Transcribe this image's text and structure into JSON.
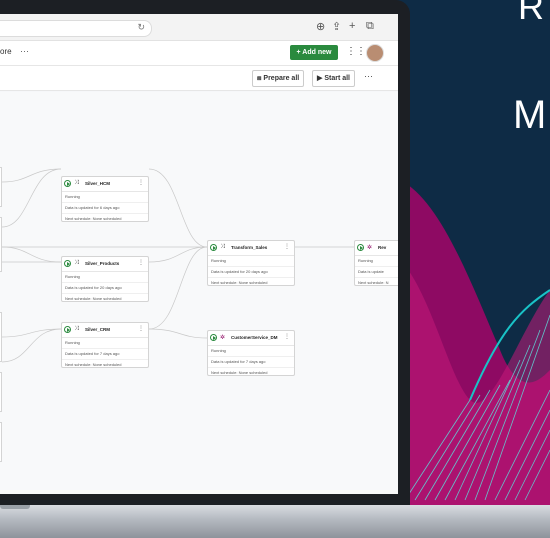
{
  "side_text": {
    "line1": "R",
    "line2": "M"
  },
  "browser": {
    "reload_icon": "reload-icon"
  },
  "app_header": {
    "left_text": "ore",
    "more_dots": "···",
    "add_new_label": "+ Add new",
    "grid_icon": "grid-icon"
  },
  "toolbar": {
    "prepare_all_label": "Prepare all",
    "start_all_label": "Start all",
    "more_dots": "···"
  },
  "nodes": [
    {
      "title": "Silver_HCM",
      "status": "Running",
      "updated": "Data is updated for 6 days ago",
      "schedule": "Next schedule: None scheduled"
    },
    {
      "title": "Silver_Products",
      "status": "Running",
      "updated": "Data is updated for 20 days ago",
      "schedule": "Next schedule: None scheduled"
    },
    {
      "title": "Silver_CRM",
      "status": "Running",
      "updated": "Data is updated for 7 days ago",
      "schedule": "Next schedule: None scheduled"
    },
    {
      "title": "Transform_Sales",
      "status": "Running",
      "updated": "Data is updated for 20 days ago",
      "schedule": "Next schedule: None scheduled"
    },
    {
      "title": "CustomerService_DM",
      "status": "Running",
      "updated": "Data is updated for 7 days ago",
      "schedule": "Next schedule: None scheduled"
    },
    {
      "title": "Rev",
      "status": "Running",
      "updated": "Data is update",
      "schedule": "Next schedule: N"
    }
  ],
  "colors": {
    "accent": "#2a8a3e",
    "bg": "#0e2b45",
    "magenta": "#8e0a63",
    "teal": "#19c3c7"
  }
}
